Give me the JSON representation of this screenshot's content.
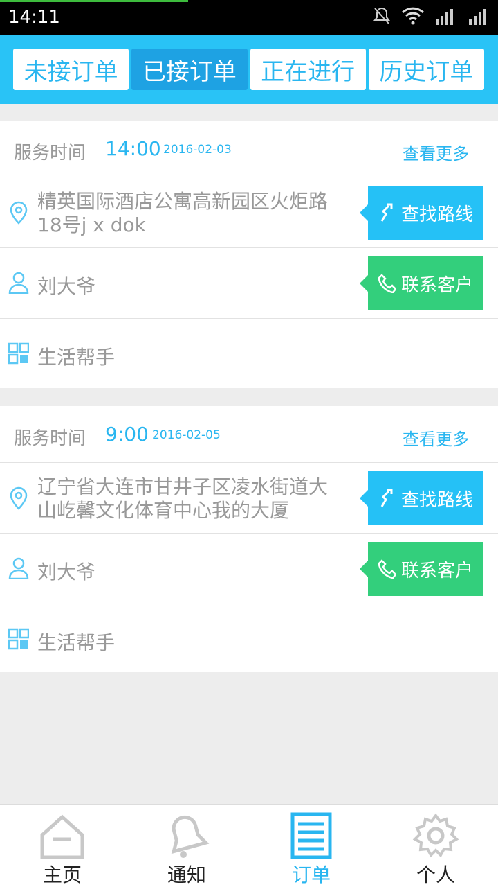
{
  "status_bar": {
    "time": "14:11"
  },
  "tabs": [
    {
      "label": "未接订单",
      "active": false
    },
    {
      "label": "已接订单",
      "active": true
    },
    {
      "label": "正在进行",
      "active": false
    },
    {
      "label": "历史订单",
      "active": false
    }
  ],
  "orders": [
    {
      "service_label": "服务时间",
      "time": "14:00",
      "date": "2016-02-03",
      "more": "查看更多",
      "address": "精英国际酒店公寓高新园区火炬路18号j x dok",
      "route_btn": "查找路线",
      "customer": "刘大爷",
      "call_btn": "联系客户",
      "service_type": "生活帮手"
    },
    {
      "service_label": "服务时间",
      "time": "9:00",
      "date": "2016-02-05",
      "more": "查看更多",
      "address": "辽宁省大连市甘井子区凌水街道大山屹馨文化体育中心我的大厦",
      "route_btn": "查找路线",
      "customer": "刘大爷",
      "call_btn": "联系客户",
      "service_type": "生活帮手"
    }
  ],
  "nav": [
    {
      "label": "主页",
      "icon": "home-icon",
      "active": false
    },
    {
      "label": "通知",
      "icon": "bell-icon",
      "active": false
    },
    {
      "label": "订单",
      "icon": "list-icon",
      "active": true
    },
    {
      "label": "个人",
      "icon": "gear-icon",
      "active": false
    }
  ],
  "colors": {
    "accent": "#29c3f6",
    "active_tab": "#1ea2e3",
    "call": "#33cf7c",
    "muted_text": "#999999"
  }
}
